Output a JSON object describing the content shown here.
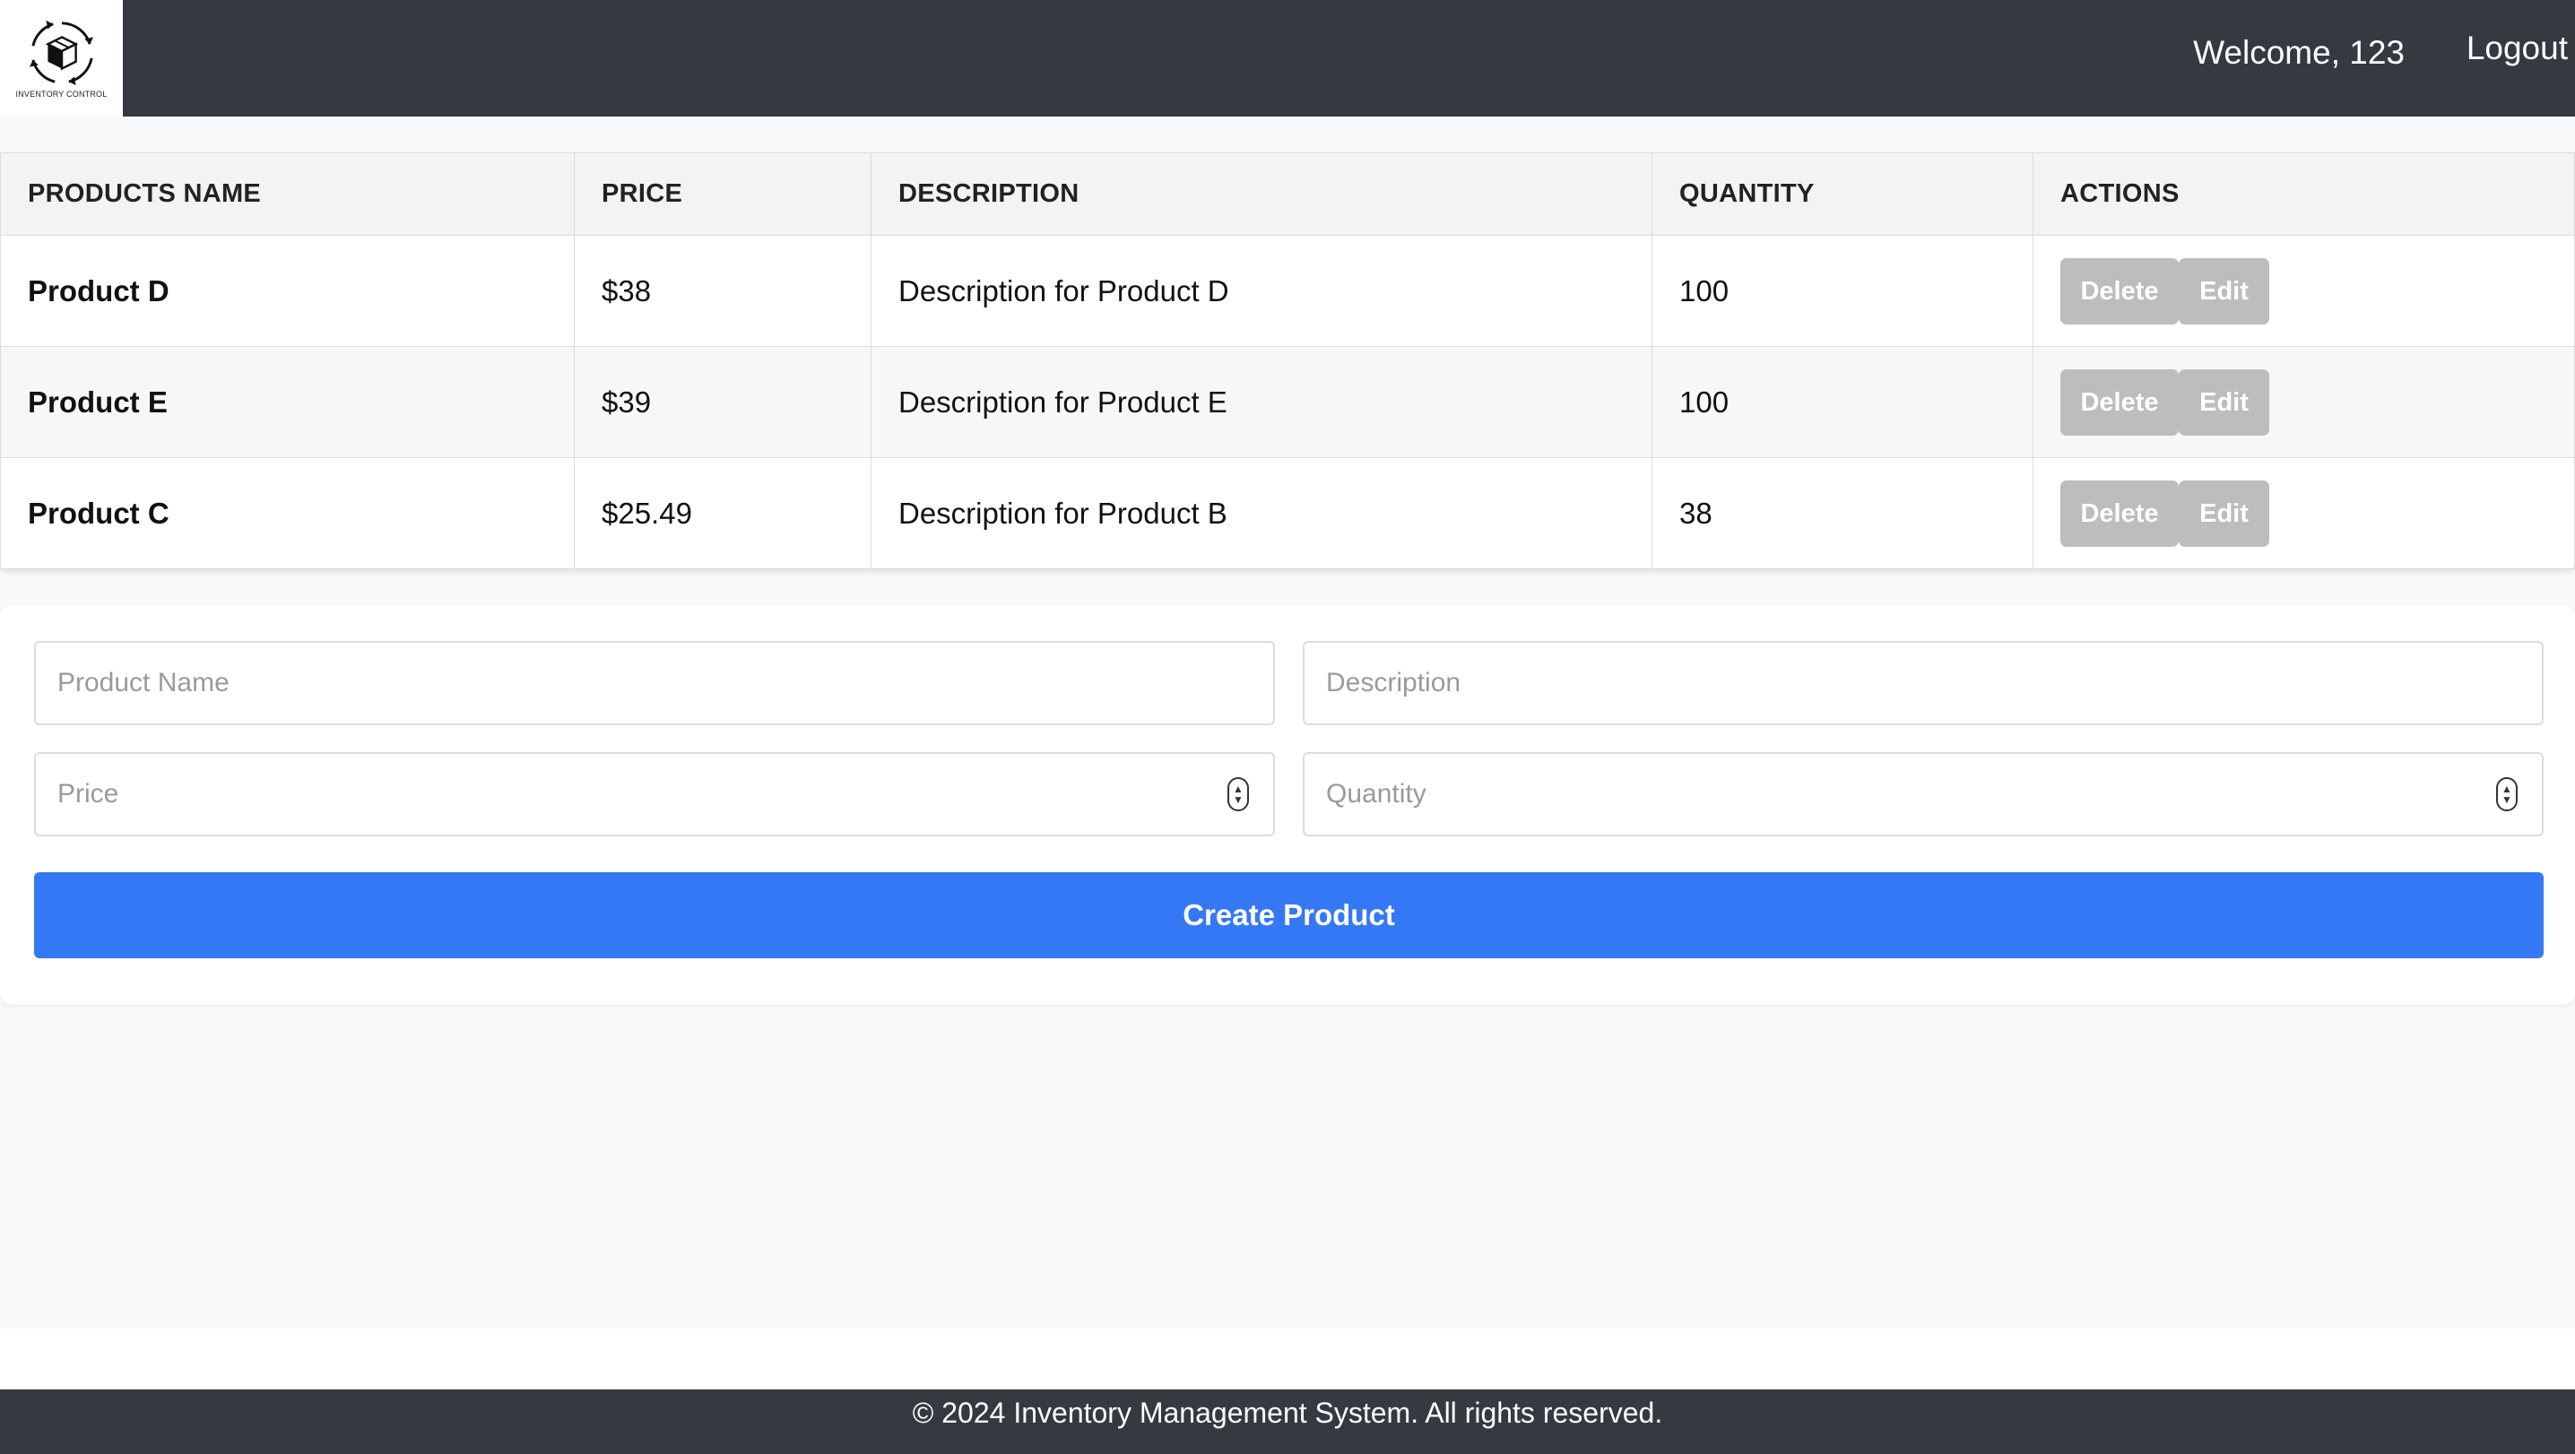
{
  "header": {
    "logo_text": "INVENTORY CONTROL",
    "welcome": "Welcome, 123",
    "logout": "Logout"
  },
  "table": {
    "columns": [
      "PRODUCTS NAME",
      "PRICE",
      "DESCRIPTION",
      "QUANTITY",
      "ACTIONS"
    ],
    "rows": [
      {
        "name": "Product D",
        "price": "$38",
        "description": "Description for Product D",
        "quantity": "100",
        "delete": "Delete",
        "edit": "Edit"
      },
      {
        "name": "Product E",
        "price": "$39",
        "description": "Description for Product E",
        "quantity": "100",
        "delete": "Delete",
        "edit": "Edit"
      },
      {
        "name": "Product C",
        "price": "$25.49",
        "description": "Description for Product B",
        "quantity": "38",
        "delete": "Delete",
        "edit": "Edit"
      }
    ]
  },
  "form": {
    "product_name_placeholder": "Product Name",
    "description_placeholder": "Description",
    "price_placeholder": "Price",
    "quantity_placeholder": "Quantity",
    "submit_label": "Create Product"
  },
  "footer": {
    "text": "© 2024 Inventory Management System. All rights reserved."
  },
  "colors": {
    "header_bg": "#343a40",
    "primary": "#3578f6",
    "disabled_button": "#bdbdbd"
  },
  "icons": {
    "logo": "inventory-cycle-box-icon",
    "stepper": "number-stepper-icon"
  }
}
